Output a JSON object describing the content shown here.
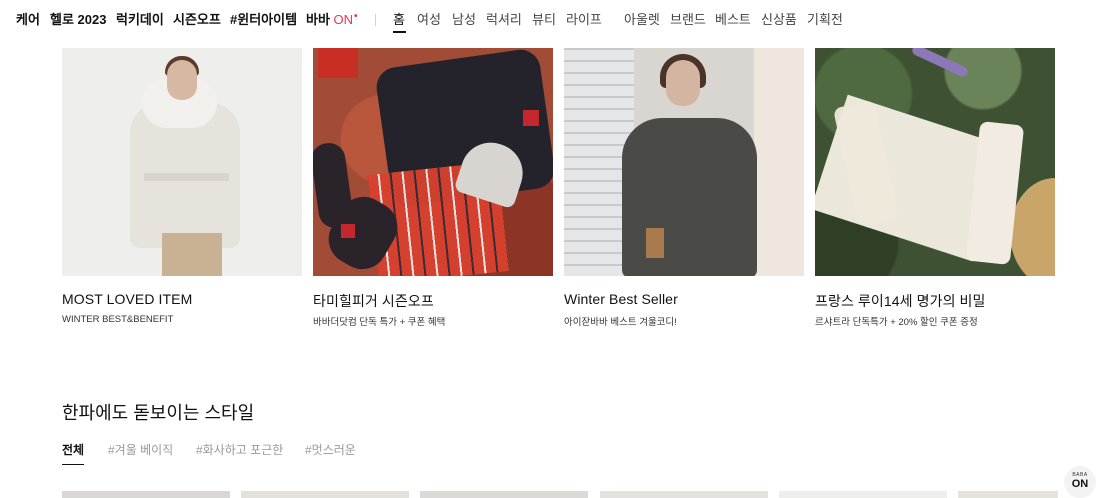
{
  "nav": {
    "items": [
      {
        "label": "케어"
      },
      {
        "label": "헬로 2023"
      },
      {
        "label": "럭키데이"
      },
      {
        "label": "시즌오프"
      },
      {
        "label": "#윈터아이템"
      },
      {
        "label": "바바",
        "accent": "ON",
        "dot": "•"
      }
    ],
    "categories": [
      {
        "label": "홈",
        "active": true
      },
      {
        "label": "여성"
      },
      {
        "label": "남성"
      },
      {
        "label": "럭셔리"
      },
      {
        "label": "뷰티"
      },
      {
        "label": "라이프"
      }
    ],
    "extras": [
      {
        "label": "아울렛"
      },
      {
        "label": "브랜드"
      },
      {
        "label": "베스트"
      },
      {
        "label": "신상품"
      },
      {
        "label": "기획전"
      }
    ],
    "accent_color": "#e8355a"
  },
  "banners": [
    {
      "title": "MOST LOVED ITEM",
      "subtitle": "WINTER BEST&BENEFIT"
    },
    {
      "title": "타미힐피거 시즌오프",
      "subtitle": "바바더닷컴 단독 특가 + 쿠폰 혜택"
    },
    {
      "title": "Winter Best Seller",
      "subtitle": "아이잗바바 베스트 겨울코디!"
    },
    {
      "title": "프랑스 루이14세 명가의 비밀",
      "subtitle": "르샤트라 단독특가 + 20% 할인 쿠폰 증정"
    }
  ],
  "style_section": {
    "title": "한파에도 돋보이는 스타일",
    "tabs": [
      {
        "label": "전체",
        "active": true
      },
      {
        "label": "#겨울 베이직"
      },
      {
        "label": "#화사하고 포근한"
      },
      {
        "label": "#멋스러운"
      }
    ]
  },
  "floating_button": {
    "top": "BABA",
    "bottom": "ON"
  }
}
